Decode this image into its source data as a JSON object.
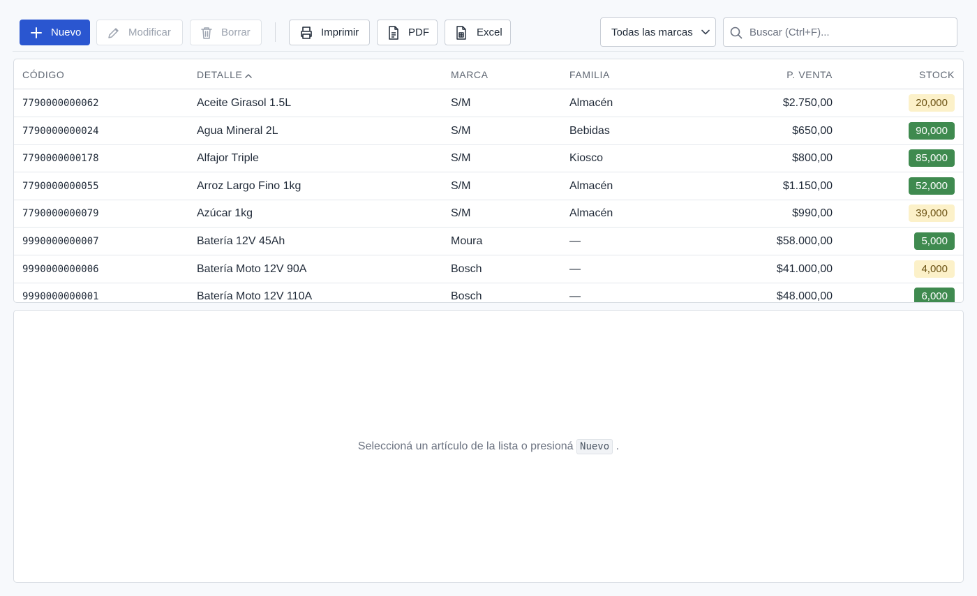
{
  "toolbar": {
    "new_label": "Nuevo",
    "edit_label": "Modificar",
    "delete_label": "Borrar",
    "print_label": "Imprimir",
    "pdf_label": "PDF",
    "excel_label": "Excel",
    "brand_filter": {
      "selected": "Todas las marcas"
    },
    "search": {
      "placeholder": "Buscar (Ctrl+F)..."
    }
  },
  "table": {
    "columns": {
      "code": "CÓDIGO",
      "detail": "DETALLE",
      "brand": "MARCA",
      "family": "FAMILIA",
      "price": "P. VENTA",
      "stock": "STOCK"
    },
    "sort": {
      "column": "DETALLE",
      "direction": "ascending"
    },
    "rows": [
      {
        "code": "7790000000062",
        "detail": "Aceite Girasol 1.5L",
        "brand": "S/M",
        "family": "Almacén",
        "price": "$2.750,00",
        "stock": "20,000",
        "stock_status": "low"
      },
      {
        "code": "7790000000024",
        "detail": "Agua Mineral 2L",
        "brand": "S/M",
        "family": "Bebidas",
        "price": "$650,00",
        "stock": "90,000",
        "stock_status": "high"
      },
      {
        "code": "7790000000178",
        "detail": "Alfajor Triple",
        "brand": "S/M",
        "family": "Kiosco",
        "price": "$800,00",
        "stock": "85,000",
        "stock_status": "high"
      },
      {
        "code": "7790000000055",
        "detail": "Arroz Largo Fino 1kg",
        "brand": "S/M",
        "family": "Almacén",
        "price": "$1.150,00",
        "stock": "52,000",
        "stock_status": "high"
      },
      {
        "code": "7790000000079",
        "detail": "Azúcar 1kg",
        "brand": "S/M",
        "family": "Almacén",
        "price": "$990,00",
        "stock": "39,000",
        "stock_status": "low"
      },
      {
        "code": "9990000000007",
        "detail": "Batería 12V 45Ah",
        "brand": "Moura",
        "family": "—",
        "price": "$58.000,00",
        "stock": "5,000",
        "stock_status": "high"
      },
      {
        "code": "9990000000006",
        "detail": "Batería Moto 12V 90A",
        "brand": "Bosch",
        "family": "—",
        "price": "$41.000,00",
        "stock": "4,000",
        "stock_status": "low"
      },
      {
        "code": "9990000000001",
        "detail": "Batería Moto 12V 110A",
        "brand": "Bosch",
        "family": "—",
        "price": "$48.000,00",
        "stock": "6,000",
        "stock_status": "high"
      }
    ]
  },
  "detail_panel": {
    "empty_text": "Seleccioná un artículo de la lista o presioná",
    "empty_key": "Nuevo",
    "empty_suffix": "."
  },
  "colors": {
    "primary": "#2a56d0",
    "stock_high_bg": "#3f8a4f",
    "stock_low_bg": "#fcf1c9"
  },
  "icons": {
    "new": "plus-icon",
    "edit": "pencil-icon",
    "delete": "trash-icon",
    "print": "printer-icon",
    "pdf": "document-icon",
    "excel": "spreadsheet-document-icon",
    "select": "chevron-down-icon",
    "search": "search-icon",
    "sort": "chevron-up-icon"
  }
}
